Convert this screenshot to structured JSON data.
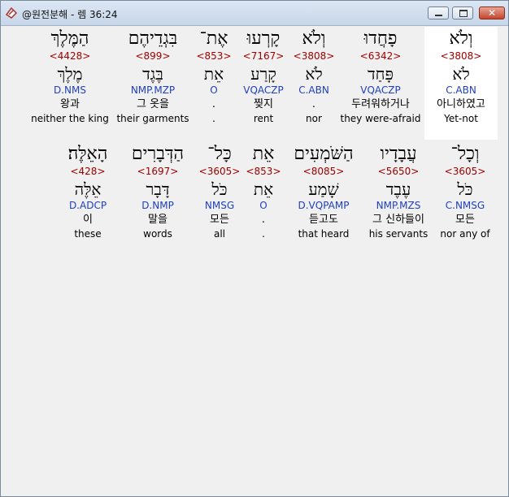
{
  "window": {
    "title": "@원전분해 - 렘 36:24"
  },
  "controls": {
    "close_glyph": "✕"
  },
  "rows": [
    {
      "words": [
        {
          "heb": "וְלֹא",
          "strong": "<3808>",
          "lemma": "לֹא",
          "parse": "C.ABN",
          "korean": "아니하였고",
          "english": "Yet-not",
          "highlight": true
        },
        {
          "heb": "פָחֲדוּ",
          "strong": "<6342>",
          "lemma": "פָּחַד",
          "parse": "VQACZP",
          "korean": "두려워하거나",
          "english": "they were-afraid"
        },
        {
          "heb": "וְלֹא",
          "strong": "<3808>",
          "lemma": "לֹא",
          "parse": "C.ABN",
          "korean": ".",
          "english": "nor"
        },
        {
          "heb": "קָרְעוּ",
          "strong": "<7167>",
          "lemma": "קָרַע",
          "parse": "VQACZP",
          "korean": "찢지",
          "english": "rent"
        },
        {
          "heb": "אֶת־",
          "strong": "<853>",
          "lemma": "אֵת",
          "parse": "O",
          "korean": ".",
          "english": "."
        },
        {
          "heb": "בִּגְדֵיהֶם",
          "strong": "<899>",
          "lemma": "בֶּגֶד",
          "parse": "NMP.MZP",
          "korean": "그 옷을",
          "english": "their garments"
        },
        {
          "heb": "הַמֶּלֶךְ",
          "strong": "<4428>",
          "lemma": "מֶלֶךְ",
          "parse": "D.NMS",
          "korean": "왕과",
          "english": "neither the king"
        }
      ]
    },
    {
      "words": [
        {
          "heb": "וְכָל־",
          "strong": "<3605>",
          "lemma": "כֹּל",
          "parse": "C.NMSG",
          "korean": "모든",
          "english": "nor any of"
        },
        {
          "heb": "עֲבָדָיו",
          "strong": "<5650>",
          "lemma": "עֶבֶד",
          "parse": "NMP.MZS",
          "korean": "그 신하들이",
          "english": "his servants"
        },
        {
          "heb": "הַשֹּׁמְעִים",
          "strong": "<8085>",
          "lemma": "שָׁמַע",
          "parse": "D.VQPAMP",
          "korean": "듣고도",
          "english": "that heard"
        },
        {
          "heb": "אֵת",
          "strong": "<853>",
          "lemma": "אֵת",
          "parse": "O",
          "korean": ".",
          "english": "."
        },
        {
          "heb": "כָּל־",
          "strong": "<3605>",
          "lemma": "כֹּל",
          "parse": "NMSG",
          "korean": "모든",
          "english": "all"
        },
        {
          "heb": "הַדְּבָרִים",
          "strong": "<1697>",
          "lemma": "דָּבָר",
          "parse": "D.NMP",
          "korean": "말을",
          "english": "words"
        },
        {
          "heb": "הָאֵלֶּה׃",
          "strong": "<428>",
          "lemma": "אֵלֶּה",
          "parse": "D.ADCP",
          "korean": "이",
          "english": "these"
        }
      ]
    }
  ]
}
